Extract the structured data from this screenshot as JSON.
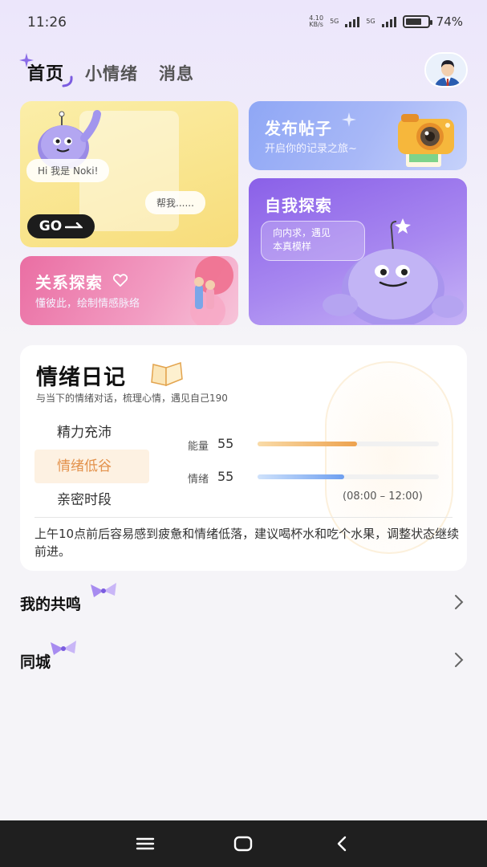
{
  "status_bar": {
    "time": "11:26",
    "net_speed_top": "4.10",
    "net_speed_bottom": "KB/s",
    "sim1": "5G",
    "sim2": "5G",
    "battery_text": "74%",
    "battery_level": 0.74
  },
  "tabs": [
    {
      "label": "首页",
      "active": true
    },
    {
      "label": "小情绪",
      "active": false
    },
    {
      "label": "消息",
      "active": false
    }
  ],
  "cards": {
    "noki": {
      "greeting": "Hi 我是 Noki!",
      "help": "帮我......",
      "go": "GO"
    },
    "post": {
      "title": "发布帖子",
      "subtitle": "开启你的记录之旅~"
    },
    "explore": {
      "title": "自我探索",
      "bubble_line1": "向内求，遇见",
      "bubble_line2": "本真模样"
    },
    "relation": {
      "title": "关系探索",
      "subtitle": "懂彼此，绘制情感脉络"
    }
  },
  "diary": {
    "title": "情绪日记",
    "subtitle": "与当下的情绪对话，梳理心情，遇见自己190",
    "moods": [
      {
        "label": "精力充沛",
        "active": false
      },
      {
        "label": "情绪低谷",
        "active": true
      },
      {
        "label": "亲密时段",
        "active": false
      }
    ],
    "metrics": [
      {
        "label": "能量",
        "value": "55",
        "fraction": 0.55,
        "color_from": "#f9dba8",
        "color_to": "#eda24e"
      },
      {
        "label": "情绪",
        "value": "55",
        "fraction": 0.48,
        "color_from": "#cfe2fb",
        "color_to": "#6e9ff0"
      }
    ],
    "time_range": "(08:00 – 12:00)",
    "advice": "上午10点前后容易感到疲惫和情绪低落，建议喝杯水和吃个水果，调整状态继续前进。"
  },
  "rows": [
    {
      "label": "我的共鸣"
    },
    {
      "label": "同城"
    }
  ],
  "colors": {
    "accent_purple": "#8a60e8",
    "accent_orange": "#e3914b",
    "nav_bg": "#1f1f1f"
  }
}
